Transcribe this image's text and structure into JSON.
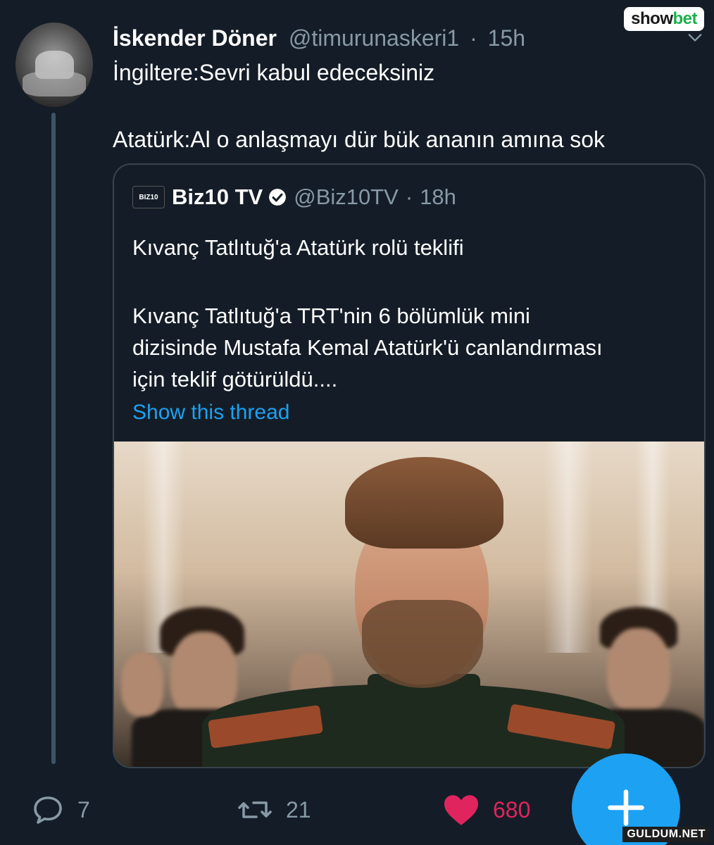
{
  "tweet": {
    "display_name": "İskender Döner",
    "handle": "@timurunaskeri1",
    "separator": "·",
    "time": "15h",
    "text_line1": "İngiltere:Sevri kabul edeceksiniz",
    "text_line2": "Atatürk:Al o anlaşmayı dür bük ananın amına sok"
  },
  "quoted": {
    "logo_text": "BIZ10",
    "display_name": "Biz10 TV",
    "handle": "@Biz10TV",
    "separator": "·",
    "time": "18h",
    "title": "Kıvanç Tatlıtuğ'a Atatürk rolü teklifi",
    "body_line1": "Kıvanç Tatlıtuğ'a TRT'nin 6 bölümlük mini",
    "body_line2": "dizisinde Mustafa Kemal Atatürk'ü canlandırması",
    "body_line3": "için teklif götürüldü....",
    "show_thread": "Show this thread"
  },
  "actions": {
    "reply_count": "7",
    "retweet_count": "21",
    "like_count": "680"
  },
  "overlay": {
    "showbet_show": "show",
    "showbet_bet": "bet",
    "watermark": "GULDUM.NET"
  },
  "colors": {
    "background": "#141d27",
    "accent": "#1da1f2",
    "like": "#e0245e",
    "muted": "#8899a6"
  },
  "icons": [
    "chevron-down-icon",
    "verified-icon",
    "reply-icon",
    "retweet-icon",
    "heart-icon",
    "plus-icon"
  ]
}
